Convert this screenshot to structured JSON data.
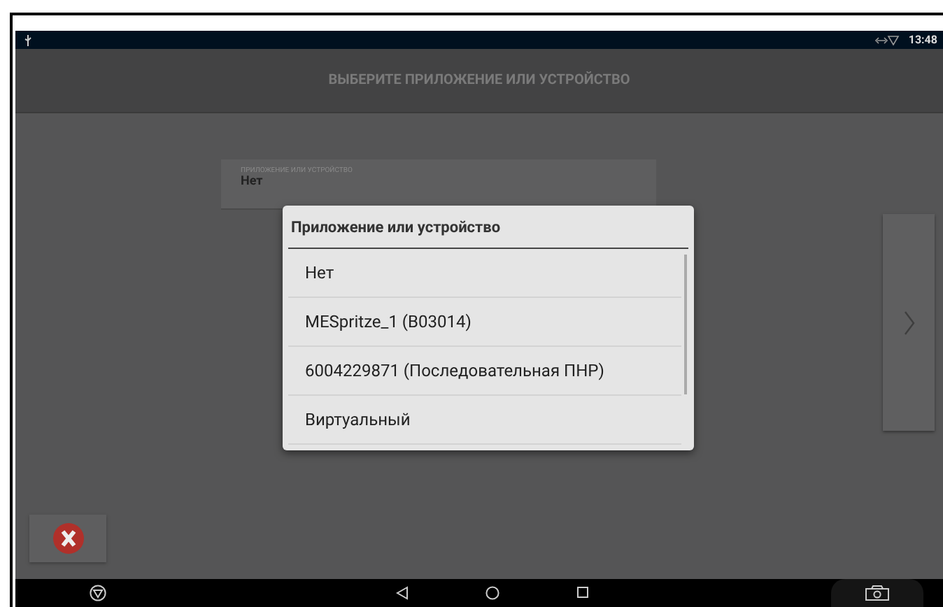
{
  "status_bar": {
    "time": "13:48"
  },
  "header": {
    "title": "ВЫБЕРИТЕ ПРИЛОЖЕНИЕ ИЛИ УСТРОЙСТВО"
  },
  "field": {
    "label": "ПРИЛОЖЕНИЕ ИЛИ УСТРОЙСТВО",
    "value": "Нет"
  },
  "dialog": {
    "title": "Приложение или устройство",
    "items": [
      {
        "label": "Нет"
      },
      {
        "label": "MESpritze_1 (B03014)"
      },
      {
        "label": "6004229871 (Последовательная ПНР)"
      },
      {
        "label": "Виртуальный"
      }
    ]
  }
}
